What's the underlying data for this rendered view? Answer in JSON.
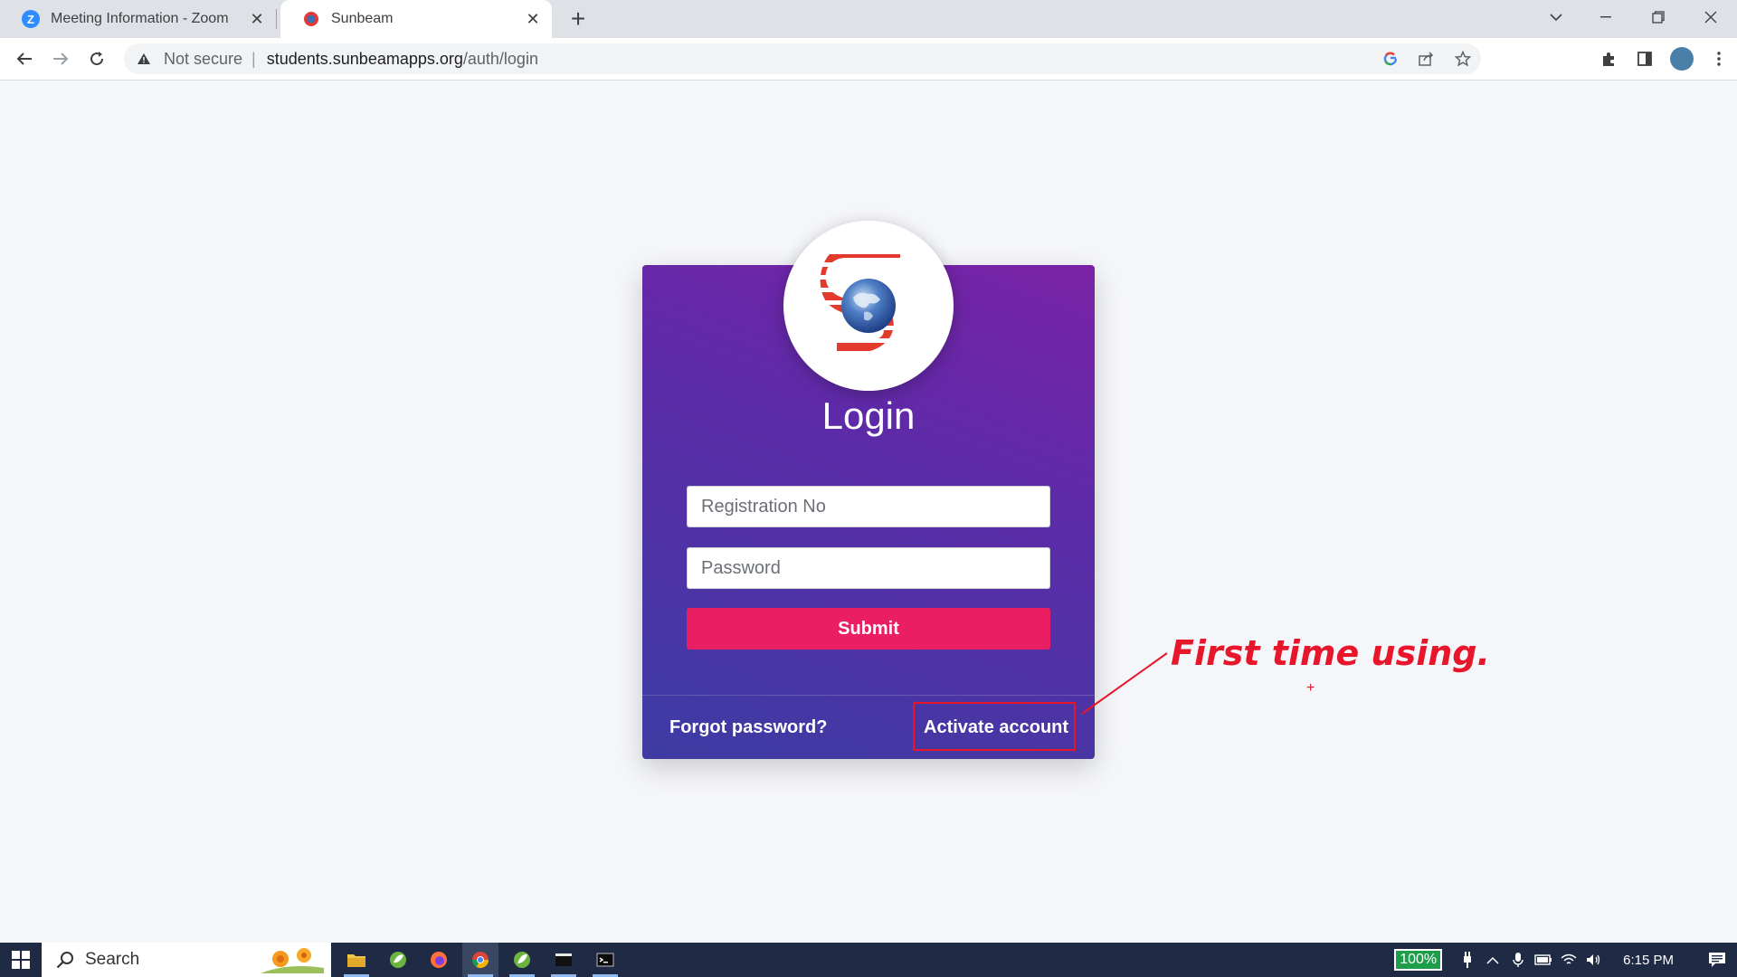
{
  "browser": {
    "tabs": [
      {
        "title": "Meeting Information - Zoom",
        "favicon": "zoom-icon",
        "active": false
      },
      {
        "title": "Sunbeam",
        "favicon": "sunbeam-logo-icon",
        "active": true
      }
    ],
    "address": {
      "security_label": "Not secure",
      "url_host": "students.sunbeamapps.org",
      "url_path": "/auth/login"
    }
  },
  "login": {
    "title": "Login",
    "registration_placeholder": "Registration No",
    "password_placeholder": "Password",
    "submit_label": "Submit",
    "forgot_label": "Forgot password?",
    "activate_label": "Activate account"
  },
  "annotation": {
    "text": "First time using.",
    "plus": "+",
    "color": "#e8162b"
  },
  "taskbar": {
    "search_label": "Search",
    "battery": "100%",
    "time": "6:15 PM"
  },
  "colors": {
    "card_gradient_start": "#7a22a6",
    "card_gradient_end": "#3d3ca3",
    "submit": "#e91e63"
  }
}
